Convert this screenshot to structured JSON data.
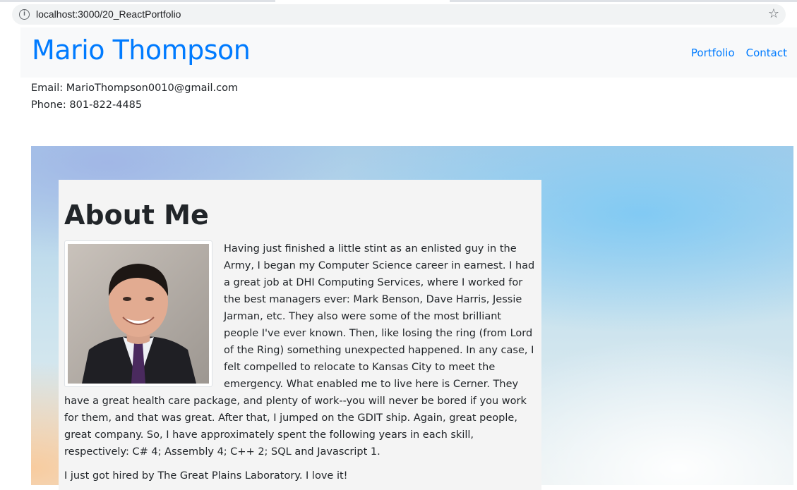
{
  "browser": {
    "url": "localhost:3000/20_ReactPortfolio",
    "info_icon": "info-icon",
    "star_icon": "star-icon"
  },
  "navbar": {
    "brand": "Mario Thompson",
    "links": [
      "Portfolio",
      "Contact"
    ],
    "link_color": "#007bff",
    "background": "#f8f9fa"
  },
  "contact": {
    "email": "Email: MarioThompson0010@gmail.com",
    "phone": "Phone: 801-822-4485"
  },
  "about": {
    "title": "About Me",
    "photo_alt": "Portrait photo",
    "bio": "Having just finished a little stint as an enlisted guy in the Army, I began my Computer Science career in earnest. I had a great job at DHI Computing Services, where I worked for the best managers ever: Mark Benson, Dave Harris, Jessie Jarman, etc. They also were some of the most brilliant people I've ever known. Then, like losing the ring (from Lord of the Ring) something unexpected happened. In any case, I felt compelled to relocate to Kansas City to meet the emergency. What enabled me to live here is Cerner. They have a great health care package, and plenty of work--you will never be bored if you work for them, and that was great. After that, I jumped on the GDIT ship. Again, great people, great company. So, I have approximately spent the following years in each skill, respectively: C# 4; Assembly 4; C++ 2; SQL and Javascript 1.",
    "bio_2": "I just got hired by The Great Plains Laboratory. I love it!"
  }
}
